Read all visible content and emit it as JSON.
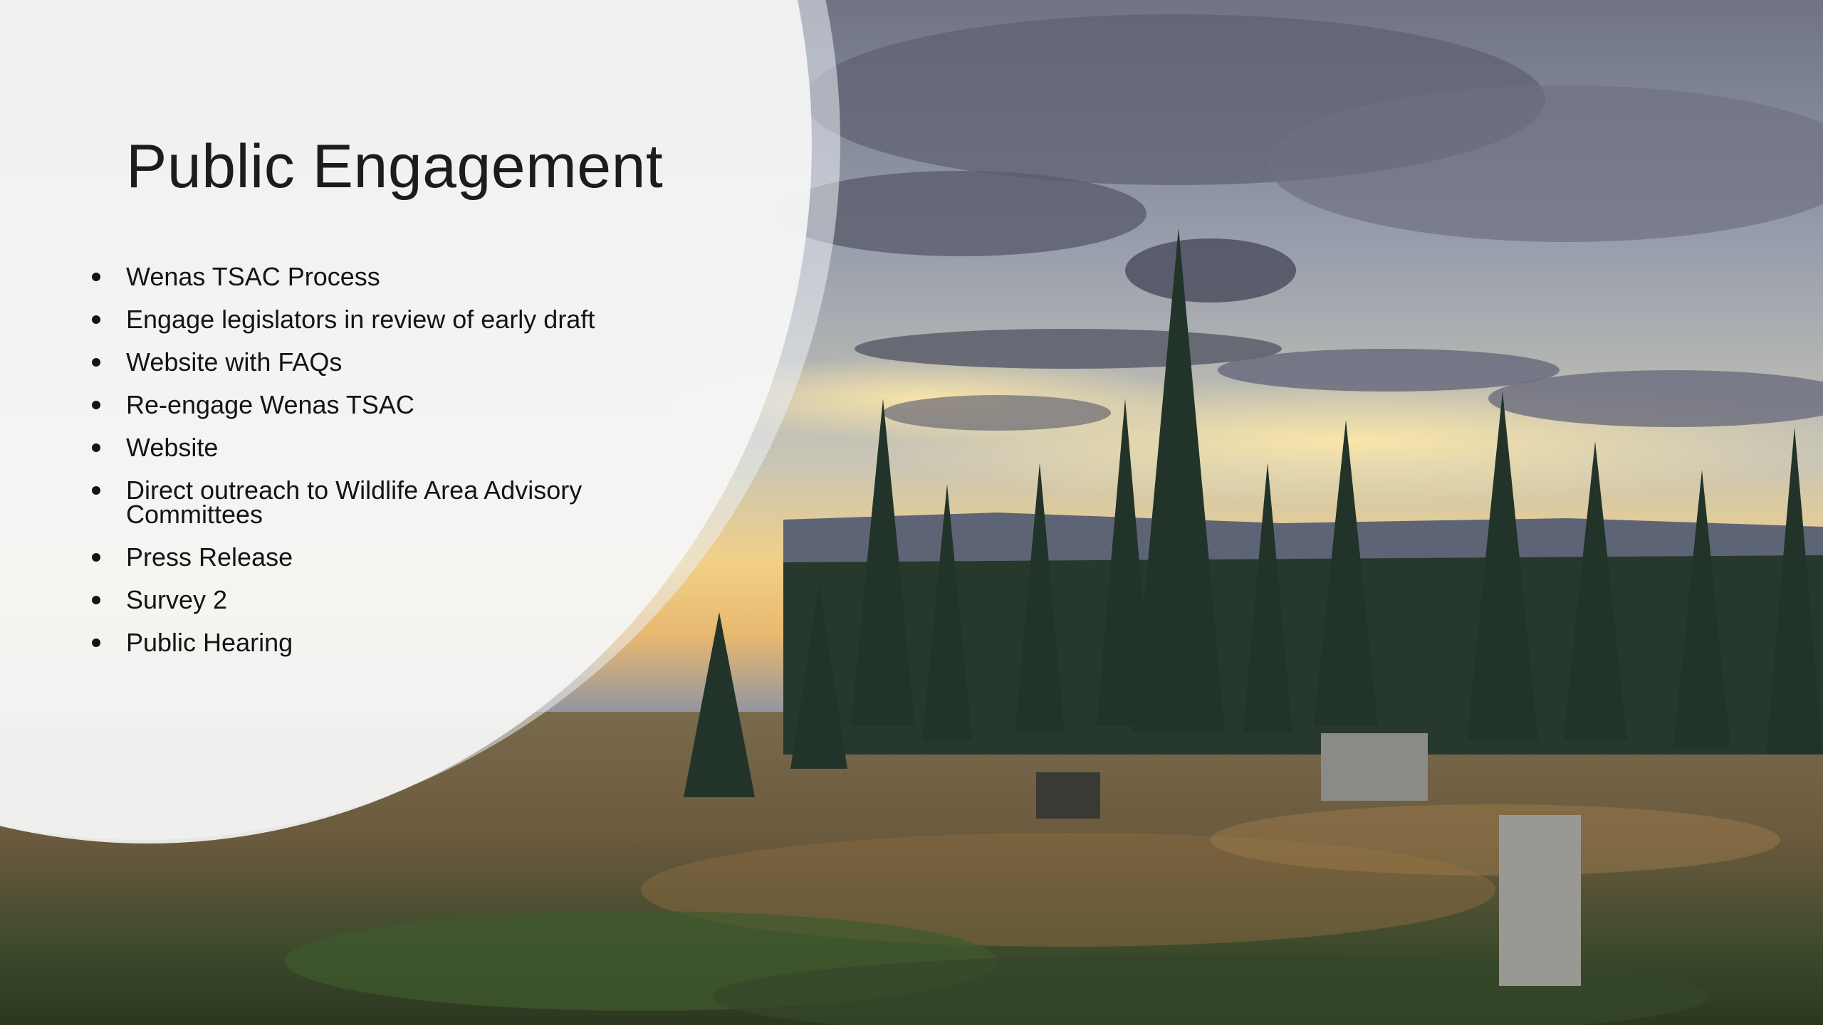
{
  "slide": {
    "title": "Public Engagement",
    "bullets": [
      "Wenas TSAC Process",
      "Engage legislators in review of early draft",
      "Website with FAQs",
      "Re-engage Wenas TSAC",
      "Website",
      "Direct outreach to Wildlife Area Advisory Committees",
      "Press Release",
      "Survey 2",
      "Public Hearing"
    ],
    "background_image": "forest-clearing-at-sunset-photo",
    "colors": {
      "title_text": "#1c1c1c",
      "body_text": "#141414",
      "panel": "#f6f6f6"
    }
  }
}
